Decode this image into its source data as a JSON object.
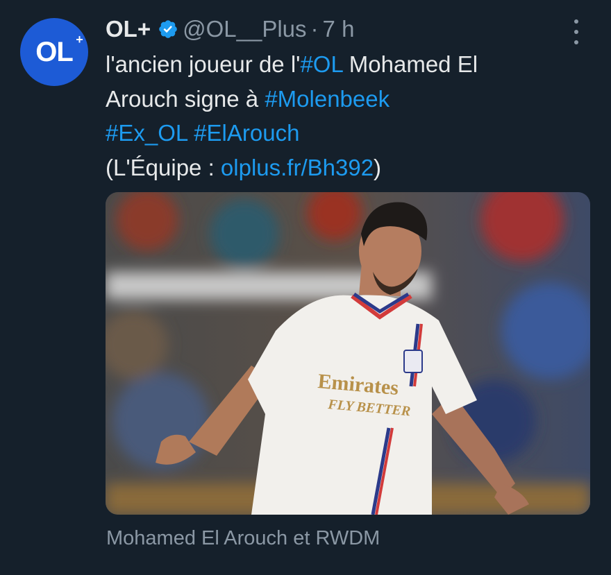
{
  "tweet": {
    "display_name": "OL+",
    "handle": "@OL__Plus",
    "separator": "·",
    "time": "7 h",
    "avatar_text": "OL",
    "avatar_sup": "+",
    "text": {
      "l1_a": "l'ancien joueur de l'",
      "l1_tag": "#OL",
      "l1_b": " Mohamed El",
      "l2_a": "Arouch signe à ",
      "l2_tag": "#Molenbeek",
      "l3_tag1": "#Ex_OL",
      "l3_space": " ",
      "l3_tag2": "#ElArouch",
      "l4_a": "(L'Équipe : ",
      "l4_link": "olplus.fr/Bh392",
      "l4_b": ")"
    },
    "media_caption": "Mohamed El Arouch et RWDM",
    "shirt_sponsor_1": "Emirates",
    "shirt_sponsor_2": "FLY BETTER"
  },
  "colors": {
    "background": "#15202b",
    "link": "#1d9bf0",
    "muted": "#8b98a5",
    "text": "#e7e9ea",
    "avatar_bg": "#1d5bd6"
  },
  "icons": {
    "verified": "verified-badge-icon",
    "more": "more-vertical-icon"
  }
}
